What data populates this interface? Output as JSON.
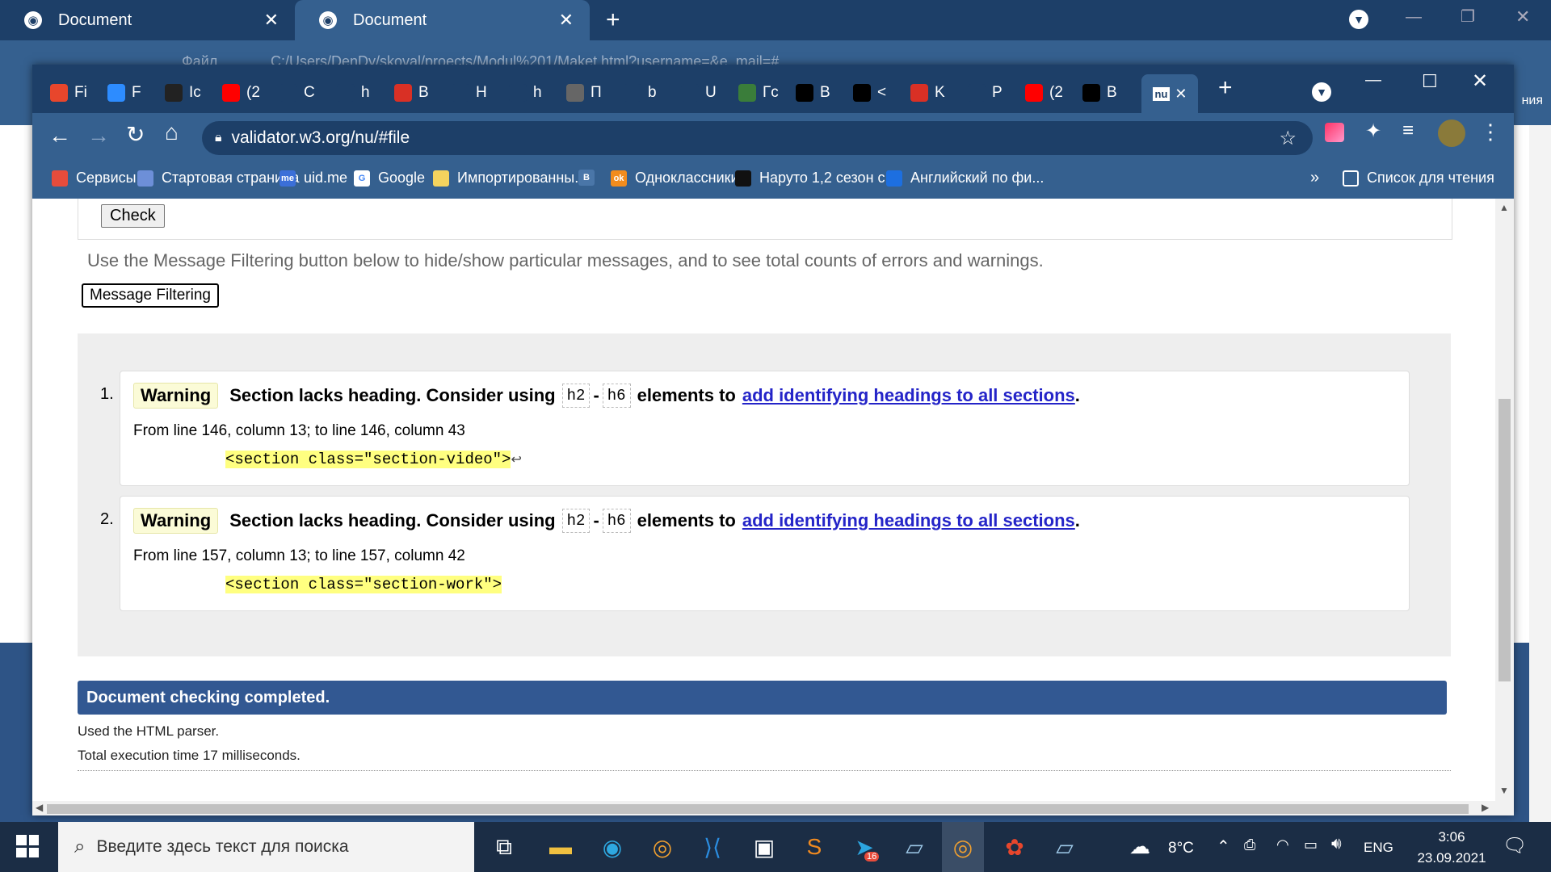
{
  "back_window": {
    "tabs": [
      {
        "title": "Document"
      },
      {
        "title": "Document"
      }
    ],
    "address_partial": "C:/Users/DenDy/skoval/proects/Modul%201/Maket.html?username=&e_mail=#",
    "file_label": "Файл",
    "side_text": "ния"
  },
  "front_window": {
    "tabs": [
      {
        "letter": "Fi",
        "color": "#e8462c"
      },
      {
        "letter": "F",
        "color": "#2d8cff"
      },
      {
        "letter": "Ic",
        "color": "#222222"
      },
      {
        "letter": "(2",
        "color": "#ff0000"
      },
      {
        "letter": "C",
        "color": "#1d3f68"
      },
      {
        "letter": "h",
        "color": "#1d3f68"
      },
      {
        "letter": "B",
        "color": "#d93025"
      },
      {
        "letter": "H",
        "color": "#1d3f68"
      },
      {
        "letter": "h",
        "color": "#1d3f68"
      },
      {
        "letter": "П",
        "color": "#666666"
      },
      {
        "letter": "b",
        "color": "#1d3f68"
      },
      {
        "letter": "U",
        "color": "#1d3f68"
      },
      {
        "letter": "Гс",
        "color": "#3a7d3a"
      },
      {
        "letter": "B",
        "color": "#000000"
      },
      {
        "letter": "<",
        "color": "#000000"
      },
      {
        "letter": "K",
        "color": "#d93025"
      },
      {
        "letter": "P",
        "color": "#1d3f68"
      },
      {
        "letter": "(2",
        "color": "#ff0000"
      },
      {
        "letter": "B",
        "color": "#000000"
      }
    ],
    "active_tab": {
      "label": "nu"
    },
    "new_tab_symbol": "+",
    "address": "validator.w3.org/nu/#file",
    "bookmarks": [
      {
        "label": "Сервисы",
        "color": "#e74c3c"
      },
      {
        "label": "Стартовая страница",
        "color": "#6d8fd8"
      },
      {
        "label": "uid.me",
        "color": "#3b6fd8",
        "icon_text": "me"
      },
      {
        "label": "Google",
        "color": "#ffffff",
        "icon_text": "G"
      },
      {
        "label": "Импортированны...",
        "color": "#f4d35e"
      },
      {
        "label": "",
        "color": "#4a76a8",
        "icon_text": "В"
      },
      {
        "label": "Одноклассники",
        "color": "#f28c1d",
        "icon_text": "ok"
      },
      {
        "label": "Наруто 1,2 сезон с...",
        "color": "#111111"
      },
      {
        "label": "Английский по фи...",
        "color": "#1d6fe0"
      }
    ],
    "bookmarks_more": "»",
    "reading_list": "Список для чтения"
  },
  "page": {
    "check_button": "Check",
    "filter_hint": "Use the Message Filtering button below to hide/show particular messages, and to see total counts of errors and warnings.",
    "filter_button": "Message Filtering",
    "messages": [
      {
        "num": "1.",
        "type": "Warning",
        "text_before": "Section lacks heading. Consider using",
        "code1": "h2",
        "dash": "-",
        "code2": "h6",
        "text_middle": "elements to",
        "link": "add identifying headings to all sections",
        "period": ".",
        "location": "From line 146, column 13; to line 146, column 43",
        "extract": "<section class=\"section-video\">",
        "extract_suffix": "↩"
      },
      {
        "num": "2.",
        "type": "Warning",
        "text_before": "Section lacks heading. Consider using",
        "code1": "h2",
        "dash": "-",
        "code2": "h6",
        "text_middle": "elements to",
        "link": "add identifying headings to all sections",
        "period": ".",
        "location": "From line 157, column 13; to line 157, column 42",
        "extract": "<section class=\"section-work\">",
        "extract_suffix": ""
      }
    ],
    "completed": "Document checking completed.",
    "parser": "Used the HTML parser.",
    "exec_time": "Total execution time 17 milliseconds."
  },
  "taskbar": {
    "search_placeholder": "Введите здесь текст для поиска",
    "weather": "8°C",
    "lang": "ENG",
    "time": "3:06",
    "date": "23.09.2021",
    "telegram_badge": "16"
  },
  "colors": {
    "accent_dark": "#1d3f68",
    "accent": "#35608f",
    "completed_bar": "#325892",
    "highlight": "#ffff80"
  }
}
